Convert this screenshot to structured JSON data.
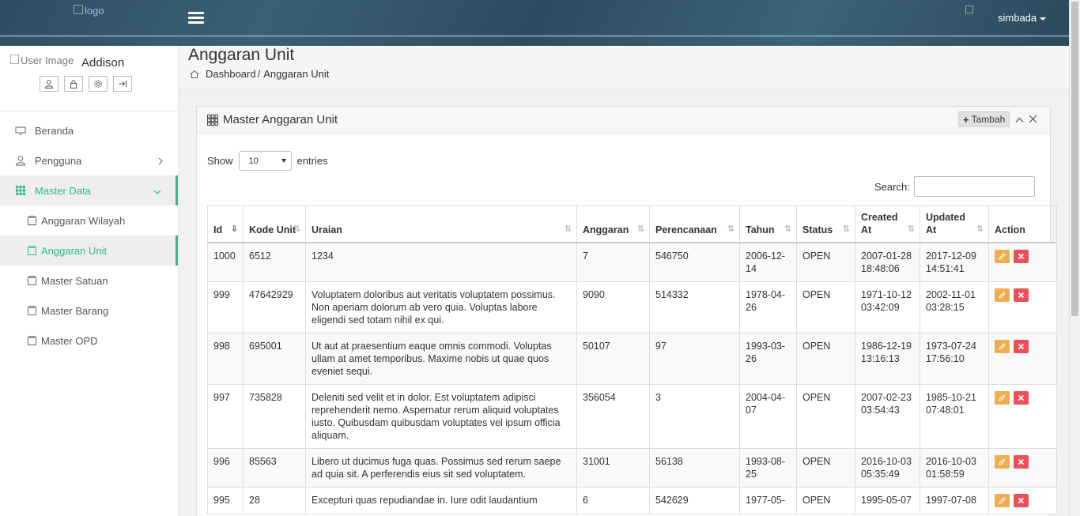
{
  "header": {
    "logo_alt": "logo",
    "user_image_alt": "User Image",
    "user_menu": "simbada"
  },
  "sidebar": {
    "profile": {
      "avatar_alt": "User Image",
      "name": "Addison"
    },
    "items": [
      {
        "label": "Beranda",
        "icon": "monitor-icon"
      },
      {
        "label": "Pengguna",
        "icon": "user-icon"
      },
      {
        "label": "Master Data",
        "icon": "grid-icon"
      }
    ],
    "sub_items": [
      {
        "label": "Anggaran Wilayah"
      },
      {
        "label": "Anggaran Unit"
      },
      {
        "label": "Master Satuan"
      },
      {
        "label": "Master Barang"
      },
      {
        "label": "Master OPD"
      }
    ]
  },
  "page": {
    "title": "Anggaran Unit",
    "breadcrumb": [
      "Dashboard",
      "Anggaran Unit"
    ],
    "breadcrumb_sep": "/"
  },
  "panel": {
    "title": "Master Anggaran Unit",
    "add_button": "Tambah",
    "show_label": "Show",
    "entries_value": "10",
    "entries_label": "entries",
    "search_label": "Search:"
  },
  "table": {
    "columns": [
      "Id",
      "Kode Unit",
      "Uraian",
      "Anggaran",
      "Perencanaan",
      "Tahun",
      "Status",
      "Created At",
      "Updated At",
      "Action"
    ],
    "rows": [
      {
        "id": "1000",
        "kode": "6512",
        "uraian": "1234",
        "anggaran": "7",
        "perencanaan": "546750",
        "tahun": "2006-12-14",
        "status": "OPEN",
        "created": "2007-01-28 18:48:06",
        "updated": "2017-12-09 14:51:41"
      },
      {
        "id": "999",
        "kode": "47642929",
        "uraian": "Voluptatem doloribus aut veritatis voluptatem possimus. Non aperiam dolorum ab vero quia. Voluptas labore eligendi sed totam nihil ex qui.",
        "anggaran": "9090",
        "perencanaan": "514332",
        "tahun": "1978-04-26",
        "status": "OPEN",
        "created": "1971-10-12 03:42:09",
        "updated": "2002-11-01 03:28:15"
      },
      {
        "id": "998",
        "kode": "695001",
        "uraian": "Ut aut at praesentium eaque omnis commodi. Voluptas ullam at amet temporibus. Maxime nobis ut quae quos eveniet sequi.",
        "anggaran": "50107",
        "perencanaan": "97",
        "tahun": "1993-03-26",
        "status": "OPEN",
        "created": "1986-12-19 13:16:13",
        "updated": "1973-07-24 17:56:10"
      },
      {
        "id": "997",
        "kode": "735828",
        "uraian": "Deleniti sed velit et in dolor. Est voluptatem adipisci reprehenderit nemo. Aspernatur rerum aliquid voluptates iusto. Quibusdam quibusdam voluptates vel ipsum officia aliquam.",
        "anggaran": "356054",
        "perencanaan": "3",
        "tahun": "2004-04-07",
        "status": "OPEN",
        "created": "2007-02-23 03:54:43",
        "updated": "1985-10-21 07:48:01"
      },
      {
        "id": "996",
        "kode": "85563",
        "uraian": "Libero ut ducimus fuga quas. Possimus sed rerum saepe ad quia sit. A perferendis eius sit sed voluptatem.",
        "anggaran": "31001",
        "perencanaan": "56138",
        "tahun": "1993-08-25",
        "status": "OPEN",
        "created": "2016-10-03 05:35:49",
        "updated": "2016-10-03 01:58:59"
      },
      {
        "id": "995",
        "kode": "28",
        "uraian": "Excepturi quas repudiandae in. Iure odit laudantium",
        "anggaran": "6",
        "perencanaan": "542629",
        "tahun": "1977-05-",
        "status": "OPEN",
        "created": "1995-05-07",
        "updated": "1997-07-08"
      }
    ]
  }
}
